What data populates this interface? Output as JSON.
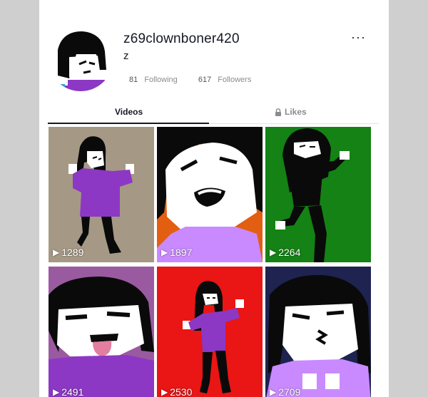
{
  "profile": {
    "username": "z69clownboner420",
    "bio": "z",
    "following_count": "81",
    "following_label": "Following",
    "followers_count": "617",
    "followers_label": "Followers",
    "more_label": "···"
  },
  "tabs": {
    "videos_label": "Videos",
    "likes_label": "Likes"
  },
  "videos": [
    {
      "views": "1289",
      "bg": "#a59985"
    },
    {
      "views": "1897",
      "bg": "#e25f12"
    },
    {
      "views": "2264",
      "bg": "#148214"
    },
    {
      "views": "2491",
      "bg": "#9a5aa0"
    },
    {
      "views": "2530",
      "bg": "#ea1515"
    },
    {
      "views": "2709",
      "bg": "#1e2350"
    }
  ],
  "colors": {
    "hair": "#0a0a0a",
    "skin": "#ffffff",
    "shirt_purple": "#8c38c4",
    "shirt_lilac": "#c98aff",
    "tongue": "#e27fa0"
  }
}
